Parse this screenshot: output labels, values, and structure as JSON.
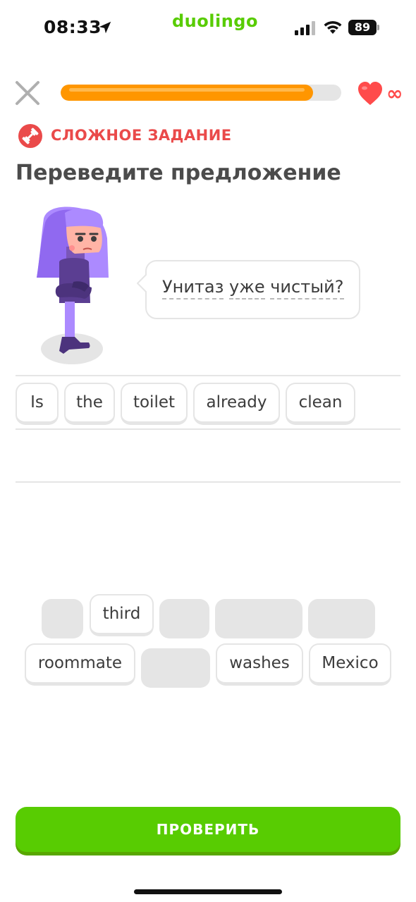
{
  "status_bar": {
    "time": "08:33",
    "brand": "duolingo",
    "battery": "89",
    "icons": [
      "location-arrow-icon",
      "cellular-signal-icon",
      "wifi-icon",
      "battery-icon"
    ]
  },
  "header": {
    "close_icon": "close-icon",
    "progress": 0.9,
    "progress_color": "#ff9600",
    "hearts_icon": "heart-icon",
    "hearts_count": "∞"
  },
  "challenge": {
    "icon": "dumbbell-icon",
    "label": "СЛОЖНОЕ ЗАДАНИЕ",
    "color": "#ea4a4a"
  },
  "title": "Переведите предложение",
  "prompt": {
    "words": [
      "Унитаз",
      "уже",
      "чистый?"
    ]
  },
  "answer": {
    "tiles": [
      "Is",
      "the",
      "toilet",
      "already",
      "clean"
    ]
  },
  "word_bank": {
    "visible_tiles": [
      "third",
      "roommate",
      "washes",
      "Mexico"
    ]
  },
  "check_button": {
    "label": "ПРОВЕРИТЬ",
    "color": "#58cc02"
  }
}
